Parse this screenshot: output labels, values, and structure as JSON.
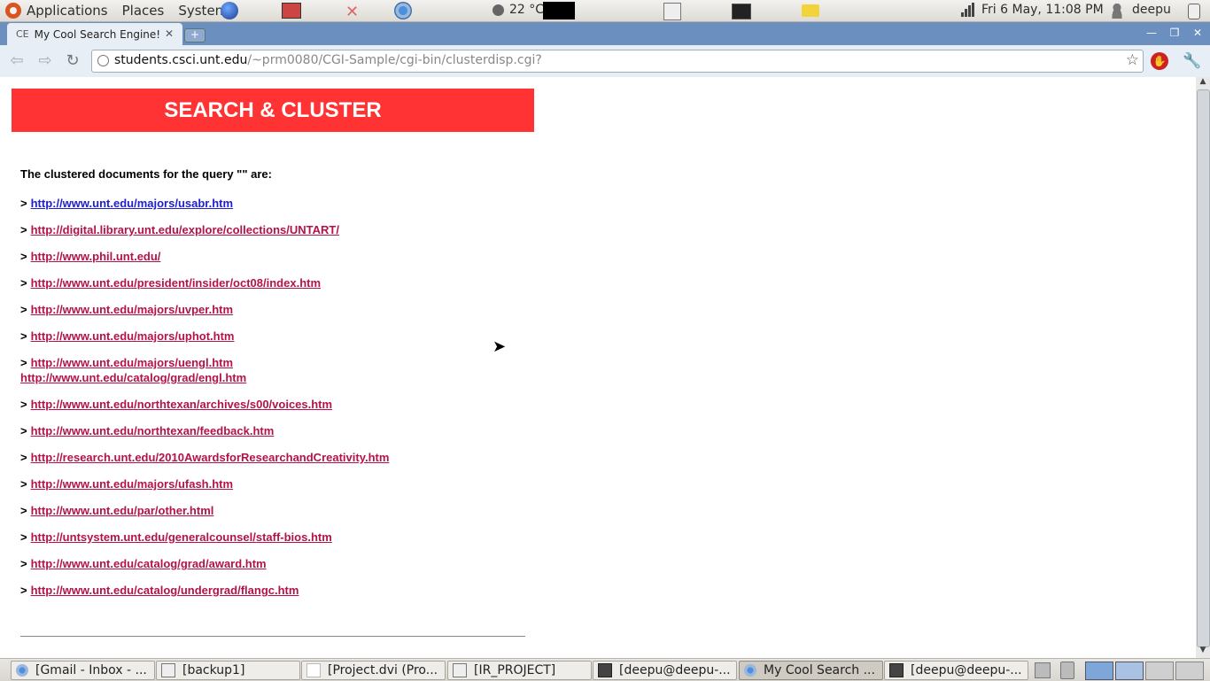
{
  "top_panel": {
    "menus": [
      "Applications",
      "Places",
      "System"
    ],
    "temperature": "22 °C",
    "clock": "Fri  6 May, 11:08 PM",
    "user": "deepu"
  },
  "browser": {
    "tab_title": "My Cool Search Engine!",
    "url_host": "students.csci.unt.edu",
    "url_path": "/~prm0080/CGI-Sample/cgi-bin/clusterdisp.cgi?"
  },
  "page": {
    "banner": "SEARCH & CLUSTER",
    "intro": "The clustered documents for the query \"\" are:",
    "marker": ">",
    "results": [
      {
        "url": "http://www.unt.edu/majors/usabr.htm"
      },
      {
        "url": "http://digital.library.unt.edu/explore/collections/UNTART/"
      },
      {
        "url": "http://www.phil.unt.edu/"
      },
      {
        "url": "http://www.unt.edu/president/insider/oct08/index.htm"
      },
      {
        "url": "http://www.unt.edu/majors/uvper.htm"
      },
      {
        "url": "http://www.unt.edu/majors/uphot.htm"
      },
      {
        "url": "http://www.unt.edu/majors/uengl.htm",
        "extra": "http://www.unt.edu/catalog/grad/engl.htm"
      },
      {
        "url": "http://www.unt.edu/northtexan/archives/s00/voices.htm"
      },
      {
        "url": "http://www.unt.edu/northtexan/feedback.htm"
      },
      {
        "url": "http://research.unt.edu/2010AwardsforResearchandCreativity.htm"
      },
      {
        "url": "http://www.unt.edu/majors/ufash.htm"
      },
      {
        "url": "http://www.unt.edu/par/other.html"
      },
      {
        "url": "http://untsystem.unt.edu/generalcounsel/staff-bios.htm"
      },
      {
        "url": "http://www.unt.edu/catalog/grad/award.htm"
      },
      {
        "url": "http://www.unt.edu/catalog/undergrad/flangc.htm"
      }
    ]
  },
  "taskbar": {
    "tasks": [
      {
        "label": "[Gmail - Inbox - ...",
        "icon": "chrome-icon"
      },
      {
        "label": "[backup1]",
        "icon": "folder-icon"
      },
      {
        "label": "[Project.dvi (Pro...",
        "icon": "document-icon"
      },
      {
        "label": "[IR_PROJECT]",
        "icon": "folder-icon"
      },
      {
        "label": "[deepu@deepu-...",
        "icon": "terminal-icon"
      },
      {
        "label": "My Cool Search ...",
        "icon": "chrome-icon"
      },
      {
        "label": "[deepu@deepu-...",
        "icon": "terminal-icon"
      }
    ]
  },
  "colors": {
    "banner": "#ff3333",
    "link": "#b3124b",
    "visited_link": "#2020cc",
    "tab_strip": "#6b8fbf"
  }
}
